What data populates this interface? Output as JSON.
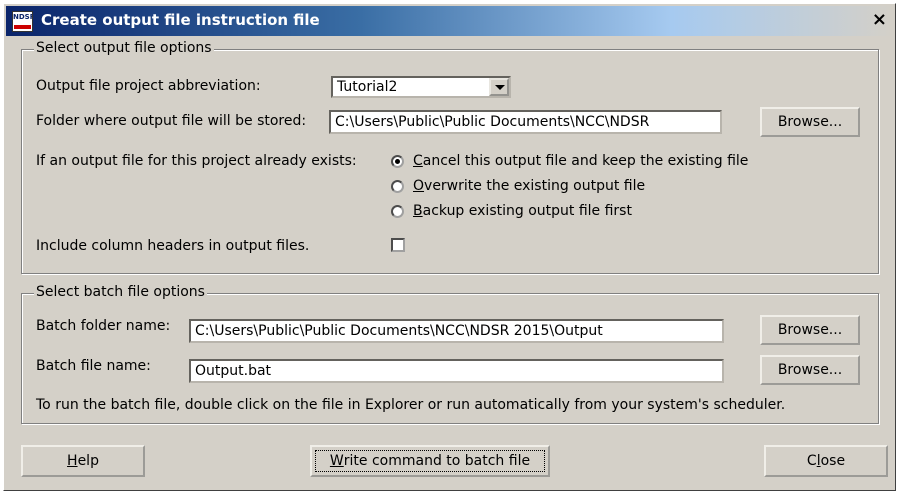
{
  "window": {
    "title": "Create output file instruction file",
    "icon_label": "NDSR",
    "close_glyph": "×"
  },
  "output_options": {
    "legend": "Select output file options",
    "abbrev_label": "Output file project abbreviation:",
    "abbrev_value": "Tutorial2",
    "folder_label": "Folder where output file will be stored:",
    "folder_value": "C:\\Users\\Public\\Public Documents\\NCC\\NDSR",
    "browse_label": "Browse...",
    "exists_label": "If an output file for this project already exists:",
    "radio_options": [
      {
        "accel": "C",
        "rest": "ancel this output file and keep the existing file",
        "selected": true
      },
      {
        "accel": "O",
        "rest": "verwrite the existing output file",
        "selected": false
      },
      {
        "accel": "B",
        "rest": "ackup existing output file first",
        "selected": false
      }
    ],
    "headers_label": "Include column headers in output files.",
    "headers_checked": false
  },
  "batch_options": {
    "legend": "Select batch file options",
    "folder_label": "Batch folder name:",
    "folder_value": "C:\\Users\\Public\\Public Documents\\NCC\\NDSR 2015\\Output",
    "file_label": "Batch file name:",
    "file_value": "Output.bat",
    "browse_label": "Browse...",
    "note": "To run the batch file, double click on the file in Explorer or run automatically from your system's scheduler."
  },
  "buttons": {
    "help": {
      "accel": "H",
      "rest": "elp"
    },
    "write": {
      "accel": "W",
      "rest": "rite command to batch file"
    },
    "close": {
      "pre": "C",
      "accel": "l",
      "rest": "ose"
    }
  },
  "colors": {
    "dialog_face": "#d4d0c8",
    "title_start": "#0a246a",
    "title_end": "#a6caf0"
  }
}
